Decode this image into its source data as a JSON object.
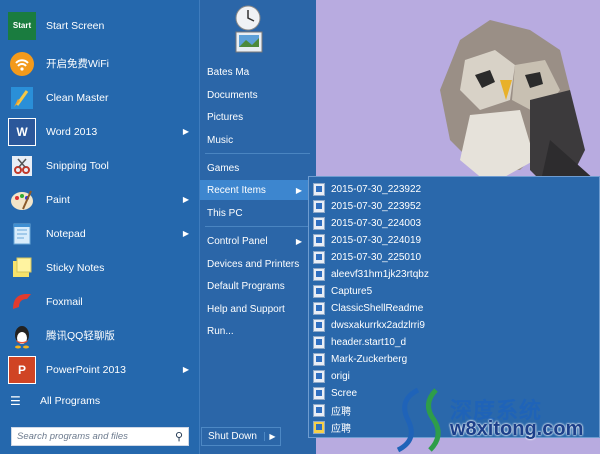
{
  "programs": [
    {
      "label": "Start Screen",
      "icon": "start-screen-icon",
      "has_arrow": false
    },
    {
      "label": "开启免费WiFi",
      "icon": "wifi-icon",
      "has_arrow": false
    },
    {
      "label": "Clean Master",
      "icon": "broom-icon",
      "has_arrow": false
    },
    {
      "label": "Word 2013",
      "icon": "word-icon",
      "has_arrow": true
    },
    {
      "label": "Snipping Tool",
      "icon": "scissors-icon",
      "has_arrow": false
    },
    {
      "label": "Paint",
      "icon": "palette-icon",
      "has_arrow": true
    },
    {
      "label": "Notepad",
      "icon": "notepad-icon",
      "has_arrow": true
    },
    {
      "label": "Sticky Notes",
      "icon": "sticky-notes-icon",
      "has_arrow": false
    },
    {
      "label": "Foxmail",
      "icon": "foxmail-icon",
      "has_arrow": false
    },
    {
      "label": "腾讯QQ轻聊版",
      "icon": "qq-penguin-icon",
      "has_arrow": false
    },
    {
      "label": "PowerPoint 2013",
      "icon": "powerpoint-icon",
      "has_arrow": true
    }
  ],
  "start_screen_tile_text": "Start",
  "word_tile_text": "W",
  "ppt_tile_text": "P",
  "all_programs": "All Programs",
  "search_placeholder": "Search programs and files",
  "right_items": [
    {
      "label": "Bates Ma",
      "has_arrow": false
    },
    {
      "label": "Documents",
      "has_arrow": false
    },
    {
      "label": "Pictures",
      "has_arrow": false
    },
    {
      "label": "Music",
      "has_arrow": false
    },
    {
      "label": "Games",
      "has_arrow": false
    },
    {
      "label": "Recent Items",
      "has_arrow": true,
      "highlighted": true
    },
    {
      "label": "This PC",
      "has_arrow": false
    },
    {
      "label": "Control Panel",
      "has_arrow": true
    },
    {
      "label": "Devices and Printers",
      "has_arrow": false
    },
    {
      "label": "Default Programs",
      "has_arrow": false
    },
    {
      "label": "Help and Support",
      "has_arrow": false
    },
    {
      "label": "Run...",
      "has_arrow": false
    }
  ],
  "shutdown_label": "Shut Down",
  "recent_items": [
    "2015-07-30_223922",
    "2015-07-30_223952",
    "2015-07-30_224003",
    "2015-07-30_224019",
    "2015-07-30_225010",
    "aleevf31hm1jk23rtqbz",
    "Capture5",
    "ClassicShellReadme",
    "dwsxakurrkx2adzlrri9",
    "header.start10_d",
    "Mark-Zuckerberg",
    "origi",
    "Scree",
    "应聘",
    "应聘"
  ],
  "watermark": {
    "title": "深度系统",
    "url": "w8xitong.com"
  },
  "colors": {
    "menu_bg": "#2568ad",
    "highlight": "#3d86cf",
    "wallpaper": "#b8abe0"
  }
}
